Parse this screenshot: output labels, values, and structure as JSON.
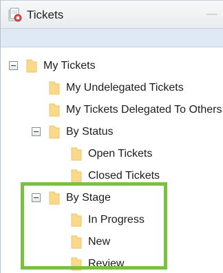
{
  "window": {
    "title": "Tickets",
    "minimize_label": "—"
  },
  "tree": {
    "root": "My Tickets",
    "undelegated": "My Undelegated Tickets",
    "delegated": "My Tickets Delegated To Others",
    "by_status": "By Status",
    "open": "Open Tickets",
    "closed": "Closed Tickets",
    "by_stage": "By Stage",
    "in_progress": "In Progress",
    "new": "New",
    "review": "Review"
  },
  "colors": {
    "folder": "#fbd98a",
    "highlight_border": "#7ac143",
    "toolbar": "#dfe9f5"
  }
}
